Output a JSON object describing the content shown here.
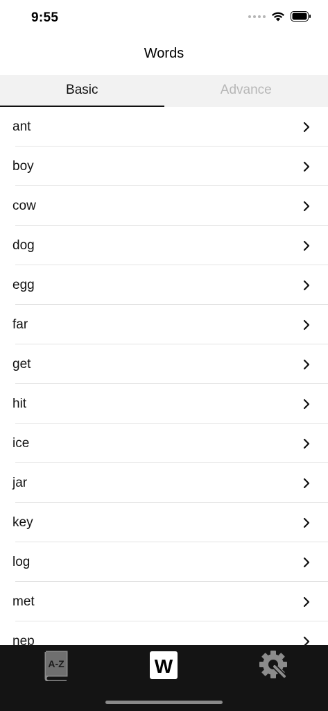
{
  "status_bar": {
    "time": "9:55"
  },
  "nav": {
    "title": "Words"
  },
  "tabs": [
    {
      "label": "Basic",
      "active": true
    },
    {
      "label": "Advance",
      "active": false
    }
  ],
  "words": [
    "ant",
    "boy",
    "cow",
    "dog",
    "egg",
    "far",
    "get",
    "hit",
    "ice",
    "jar",
    "key",
    "log",
    "met",
    "nep"
  ],
  "tab_bar": {
    "items": [
      {
        "icon": "a-z-dictionary-icon",
        "text": "A-Z"
      },
      {
        "icon": "words-w-icon",
        "text": "W",
        "active": true
      },
      {
        "icon": "settings-gear-wrench-icon"
      }
    ]
  },
  "colors": {
    "tab_bar_bg": "#141414",
    "tab_strip_bg": "#f2f2f2",
    "inactive_tab_text": "#b7b7b7",
    "separator": "#e3e3e3"
  }
}
